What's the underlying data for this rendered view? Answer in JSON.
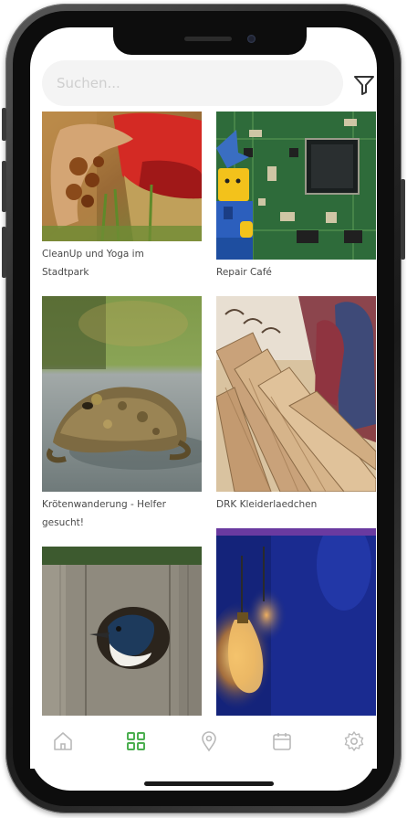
{
  "search": {
    "placeholder": "Suchen..."
  },
  "tiles": [
    {
      "label": "CleanUp und Yoga im Stadtpark"
    },
    {
      "label": "Repair Café"
    },
    {
      "label": "Krötenwanderung - Helfer gesucht!"
    },
    {
      "label": "DRK Kleiderlaedchen"
    },
    {
      "label": ""
    },
    {
      "label": ""
    }
  ],
  "tabbar": {
    "icons": [
      "home-icon",
      "grid-icon",
      "location-pin-icon",
      "calendar-icon",
      "gear-icon"
    ],
    "active_index": 1,
    "active_color": "#4caf50",
    "inactive_color": "#b9b9b9"
  }
}
